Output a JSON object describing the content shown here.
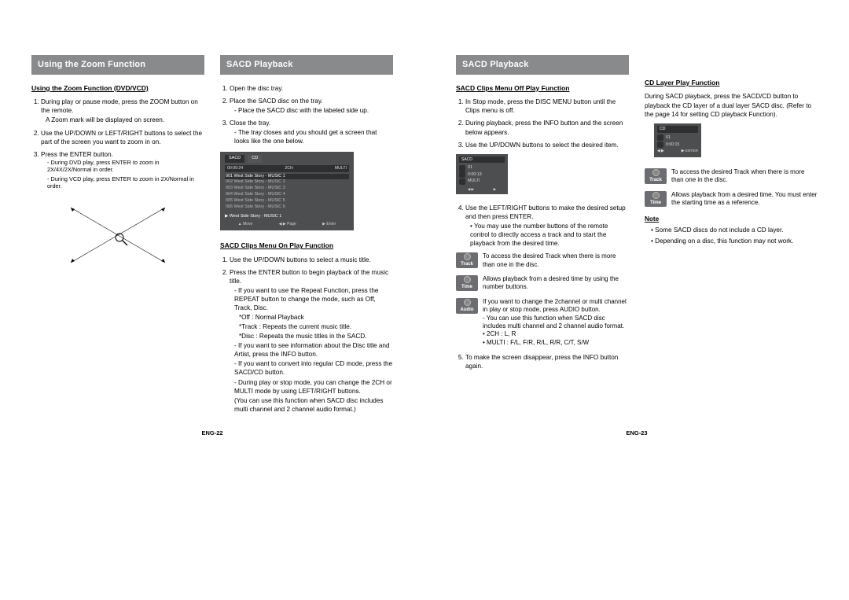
{
  "page_left": {
    "footer": "ENG-22",
    "col1": {
      "header": "Using the Zoom Function",
      "section1_title": "Using the Zoom Function (DVD/VCD)",
      "steps": [
        "During play or pause mode, press the ZOOM button on the remote.",
        "Use the UP/DOWN or LEFT/RIGHT buttons to select the part of the screen you want to zoom in on.",
        "Press the ENTER button."
      ],
      "step1_sub": "A Zoom mark will be displayed on screen.",
      "step3_fine": [
        "During DVD play, press ENTER to zoom in 2X/4X/2X/Normal in order.",
        "During VCD play, press ENTER to zoom in 2X/Normal in order."
      ]
    },
    "col2": {
      "header": "SACD Playback",
      "steps_top": [
        "Open the disc tray.",
        "Place the SACD disc on the tray.",
        "Close the tray."
      ],
      "step2_sub": "Place the SACD disc with the labeled side up.",
      "step3_sub": "The tray closes and you should get a screen that looks like the one below.",
      "osd": {
        "tab1": "SACD",
        "tab2": "CD",
        "meta_left": "00:00:24",
        "meta_mid": "2CH",
        "meta_right": "MULTI",
        "rows": [
          "001  West  Side  Story  -  MUSIC  1",
          "002  West  Side  Story  -  MUSIC  2",
          "003  West  Side  Story  -  MUSIC  3",
          "004  West  Side  Story  -  MUSIC  4",
          "005  West  Side  Story  -  MUSIC  5",
          "006  West  Side  Story  -  MUSIC  6"
        ],
        "label": "▶  West  Side  Story  -  MUSIC  1",
        "ctrls": [
          "▲ Move",
          "◀ ▶ Page",
          "▶ Enter"
        ]
      },
      "section2_title": "SACD Clips Menu On Play Function",
      "s2_steps": [
        "Use the UP/DOWN buttons to select a music title.",
        "Press the ENTER button to begin playback of the music title."
      ],
      "s2_subs": [
        "If you want to use the Repeat Function, press the REPEAT button to change the mode, such as Off, Track, Disc.",
        "If you want to see information about the Disc title and Artist, press the INFO button.",
        "If you want to convert into regular CD mode, press the SACD/CD button.",
        "During play or stop mode, you can change the 2CH or MULTI mode by using LEFT/RIGHT buttons."
      ],
      "s2_modes": [
        "*Off : Normal Playback",
        "*Track : Repeats the current music title.",
        "*Disc : Repeats the music titles in the SACD."
      ],
      "s2_tail": "(You can use this function when SACD disc includes multi channel and 2 channel audio format.)"
    }
  },
  "page_right": {
    "footer": "ENG-23",
    "col1": {
      "header": "SACD Playback",
      "section1_title": "SACD Clips Menu Off Play Function",
      "steps": [
        "In Stop mode, press the DISC MENU button until the Clips menu is off.",
        "During playback, press the INFO button and the screen below appears.",
        "Use the UP/DOWN buttons to select the desired item."
      ],
      "osd_mini": {
        "title": "SACD",
        "lines": [
          "01",
          "0:00:13",
          "MULTI"
        ]
      },
      "step4": "Use the LEFT/RIGHT buttons to make the desired setup and then press ENTER.",
      "step4_sub": "You may use the number buttons of the remote control to directly access a track and to start the playback from the desired time.",
      "icons": [
        {
          "label": "Track",
          "text": "To access the desired Track when there is more than one in the disc."
        },
        {
          "label": "Time",
          "text": "Allows playback from a desired time by using the number buttons."
        },
        {
          "label": "Audio",
          "text": "If you want to change the 2channel or multi channel in play or stop mode, press AUDIO button."
        }
      ],
      "audio_subs": [
        "You can use this function when SACD disc includes multi channel and 2 channel audio format.",
        "2CH : L, R",
        "MULTI : F/L, F/R, R/L, R/R, C/T, S/W"
      ],
      "step5": "To make the screen disappear, press the INFO button again."
    },
    "col2": {
      "section_title": "CD Layer Play Function",
      "intro": "During SACD playback, press the SACD/CD button to playback the CD layer of a dual layer SACD disc. (Refer to the page 14 for setting CD playback Function).",
      "osd": {
        "title": "CD",
        "lines": [
          "01",
          "0:00:15"
        ],
        "foot": [
          "◀ ▶",
          "▶ ENTER"
        ]
      },
      "icons": [
        {
          "label": "Track",
          "text": "To access the desired Track when there is more than one in the disc."
        },
        {
          "label": "Time",
          "text": "Allows playback from a desired time. You must enter the starting time as a reference."
        }
      ],
      "note_title": "Note",
      "notes": [
        "Some SACD discs do not include a CD layer.",
        "Depending on a disc, this function may not work."
      ]
    }
  }
}
